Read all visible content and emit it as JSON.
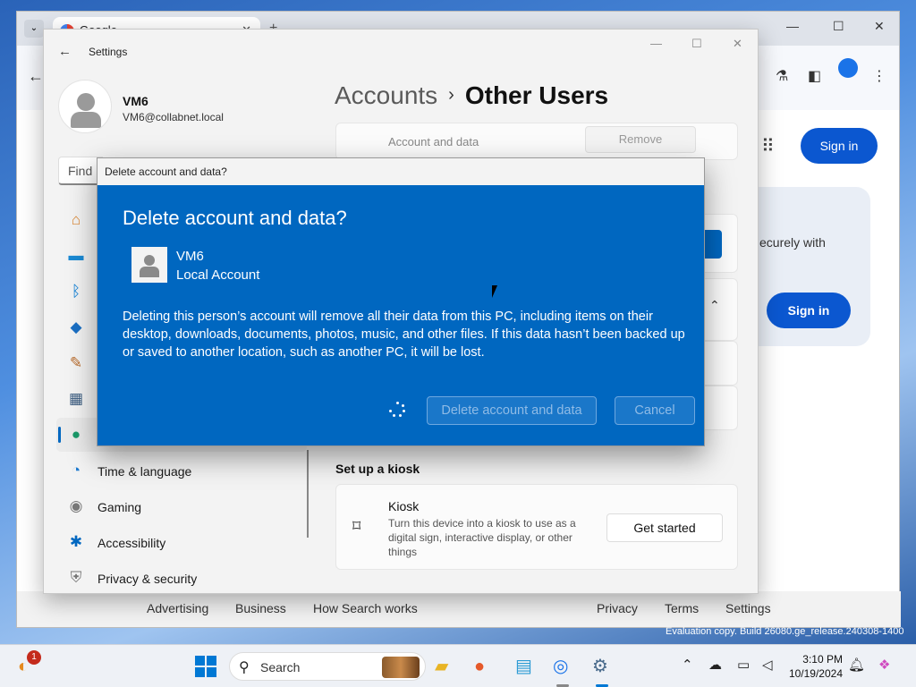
{
  "desktop": {
    "eval_copy": "Evaluation copy. Build 26080.ge_release.240308-1400"
  },
  "chrome": {
    "tab_title": "Google",
    "sign_in_top": "Sign in",
    "card_text": "ecurely with",
    "sign_in_card": "Sign in",
    "footer": {
      "advertising": "Advertising",
      "business": "Business",
      "how_search_works": "How Search works",
      "privacy": "Privacy",
      "terms": "Terms",
      "settings": "Settings"
    }
  },
  "settings": {
    "window_title": "Settings",
    "user": {
      "name": "VM6",
      "email": "VM6@collabnet.local"
    },
    "find_placeholder": "Find",
    "breadcrumb": {
      "parent": "Accounts",
      "separator": "›",
      "current": "Other Users"
    },
    "account_row": {
      "label": "Account and data",
      "remove": "Remove"
    },
    "nav": [
      {
        "label": "Time & language",
        "icon": "clock-globe-icon"
      },
      {
        "label": "Gaming",
        "icon": "gamepad-icon"
      },
      {
        "label": "Accessibility",
        "icon": "accessibility-icon"
      },
      {
        "label": "Privacy & security",
        "icon": "shield-icon"
      }
    ],
    "kiosk": {
      "heading": "Set up a kiosk",
      "title": "Kiosk",
      "description": "Turn this device into a kiosk to use as a digital sign, interactive display, or other things",
      "button": "Get started"
    }
  },
  "modal": {
    "titlebar": "Delete account and data?",
    "heading": "Delete account and data?",
    "account_name": "VM6",
    "account_type": "Local Account",
    "message": "Deleting this person’s account will remove all their data from this PC, including items on their desktop, downloads, documents, photos, music, and other files. If this data hasn’t been backed up or saved to another location, such as another PC, it will be lost.",
    "delete_button": "Delete account and data",
    "cancel_button": "Cancel"
  },
  "taskbar": {
    "search_label": "Search",
    "time": "3:10 PM",
    "date": "10/19/2024",
    "notification_badge": "1",
    "accent": "#0078d4"
  },
  "colors": {
    "modal_bg": "#0067c0",
    "signin_blue": "#0b57d0"
  }
}
